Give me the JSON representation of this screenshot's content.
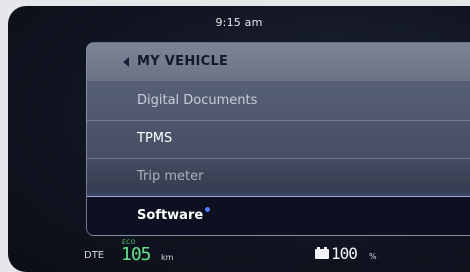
{
  "status": {
    "time": "9:15 am"
  },
  "menu": {
    "header_title": "MY VEHICLE",
    "items": [
      {
        "label": "Digital Documents"
      },
      {
        "label": "TPMS"
      },
      {
        "label": "Trip meter"
      },
      {
        "label": "Software",
        "selected": true,
        "has_update_dot": true
      }
    ]
  },
  "footer": {
    "dte_label": "DTE",
    "mode_label": "ECO",
    "range_value": "105",
    "range_unit": "km",
    "battery_value": "100",
    "battery_unit": "%"
  },
  "colors": {
    "accent_dot": "#4f7bff",
    "range_green": "#67e08a",
    "selected_border": "#9aa9d6"
  },
  "icons": {
    "back": "chevron-left-icon",
    "battery": "battery-icon",
    "update_dot": "dot-icon"
  }
}
